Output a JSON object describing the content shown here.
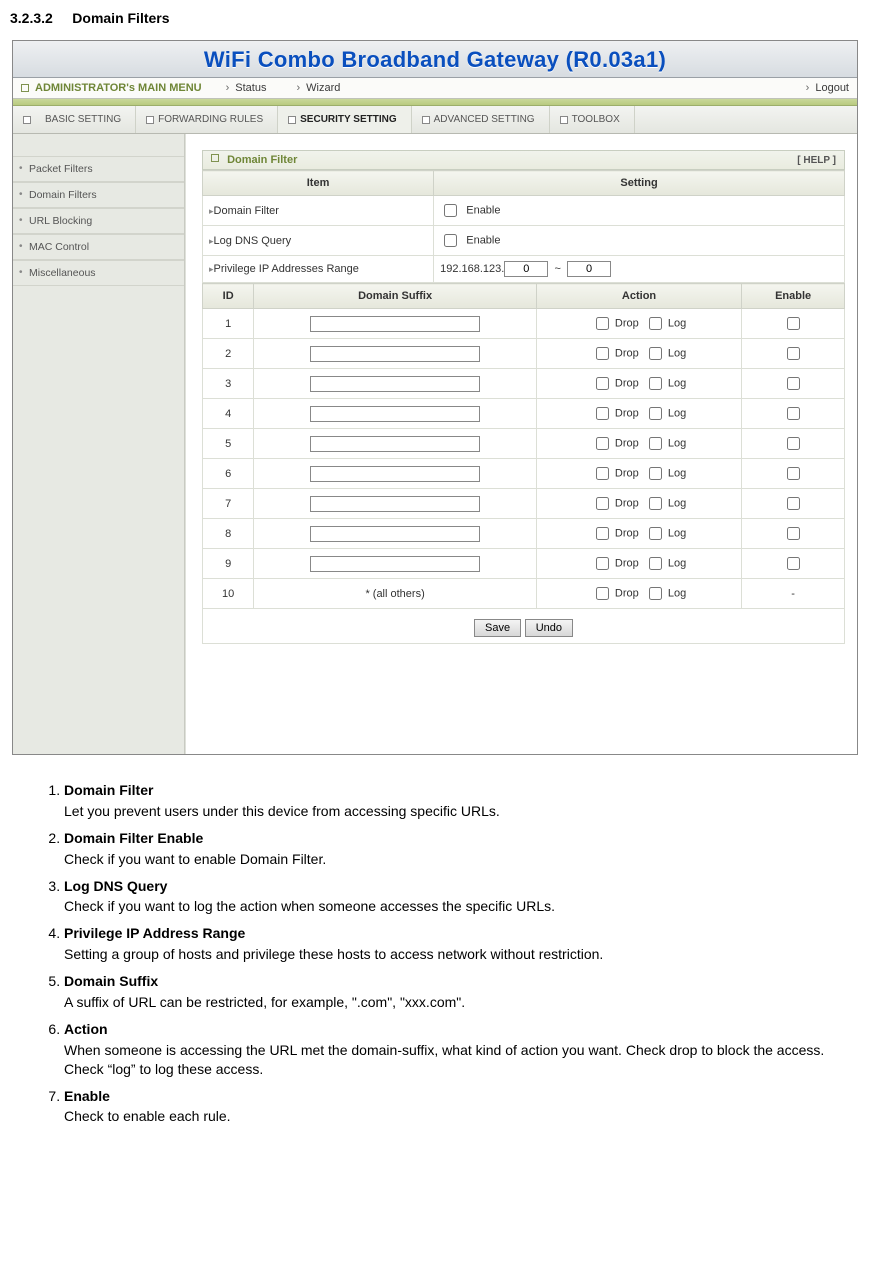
{
  "section": {
    "number": "3.2.3.2",
    "title": "Domain Filters"
  },
  "router": {
    "title": "WiFi Combo Broadband Gateway (R0.03a1)",
    "menu": {
      "admin": "ADMINISTRATOR's MAIN MENU",
      "status": "Status",
      "wizard": "Wizard",
      "logout": "Logout"
    },
    "tabs": [
      {
        "label": "BASIC SETTING"
      },
      {
        "label": "FORWARDING RULES"
      },
      {
        "label": "SECURITY SETTING",
        "active": true
      },
      {
        "label": "ADVANCED SETTING"
      },
      {
        "label": "TOOLBOX"
      }
    ],
    "sidebar": [
      "Packet Filters",
      "Domain Filters",
      "URL Blocking",
      "MAC Control",
      "Miscellaneous"
    ],
    "panel": {
      "title": "Domain Filter",
      "help": "[ HELP ]",
      "col_item": "Item",
      "col_setting": "Setting",
      "rows": {
        "domain_filter": "Domain Filter",
        "log_dns": "Log DNS Query",
        "priv_range": "Privilege IP Addresses Range"
      },
      "enable_label": "Enable",
      "ip_prefix": "192.168.123.",
      "ip_from": "0",
      "ip_sep": "~",
      "ip_to": "0",
      "cols2": {
        "id": "ID",
        "suffix": "Domain Suffix",
        "action": "Action",
        "enable": "Enable"
      },
      "action_drop": "Drop",
      "action_log": "Log",
      "rows2": [
        {
          "id": "1",
          "suffix": "",
          "others": false
        },
        {
          "id": "2",
          "suffix": "",
          "others": false
        },
        {
          "id": "3",
          "suffix": "",
          "others": false
        },
        {
          "id": "4",
          "suffix": "",
          "others": false
        },
        {
          "id": "5",
          "suffix": "",
          "others": false
        },
        {
          "id": "6",
          "suffix": "",
          "others": false
        },
        {
          "id": "7",
          "suffix": "",
          "others": false
        },
        {
          "id": "8",
          "suffix": "",
          "others": false
        },
        {
          "id": "9",
          "suffix": "",
          "others": false
        },
        {
          "id": "10",
          "suffix": "* (all others)",
          "others": true
        }
      ],
      "buttons": {
        "save": "Save",
        "undo": "Undo"
      }
    }
  },
  "desc": [
    {
      "term": "Domain Filter",
      "def": "Let you prevent users under this device from accessing specific URLs."
    },
    {
      "term": "Domain Filter Enable",
      "def": "Check if you want to enable Domain Filter."
    },
    {
      "term": "Log DNS Query",
      "def": "Check if you want to log the action when someone accesses the specific URLs."
    },
    {
      "term": "Privilege IP Address Range",
      "def": "Setting a group of hosts and privilege these hosts to access network without restriction."
    },
    {
      "term": "Domain Suffix",
      "def": "A suffix of URL can be restricted, for example, \".com\", \"xxx.com\"."
    },
    {
      "term": "Action",
      "def": "When someone is accessing the URL met the domain-suffix, what kind of action you want. Check drop to block the access. Check “log” to log these access."
    },
    {
      "term": "Enable",
      "def": "Check to enable each rule."
    }
  ]
}
